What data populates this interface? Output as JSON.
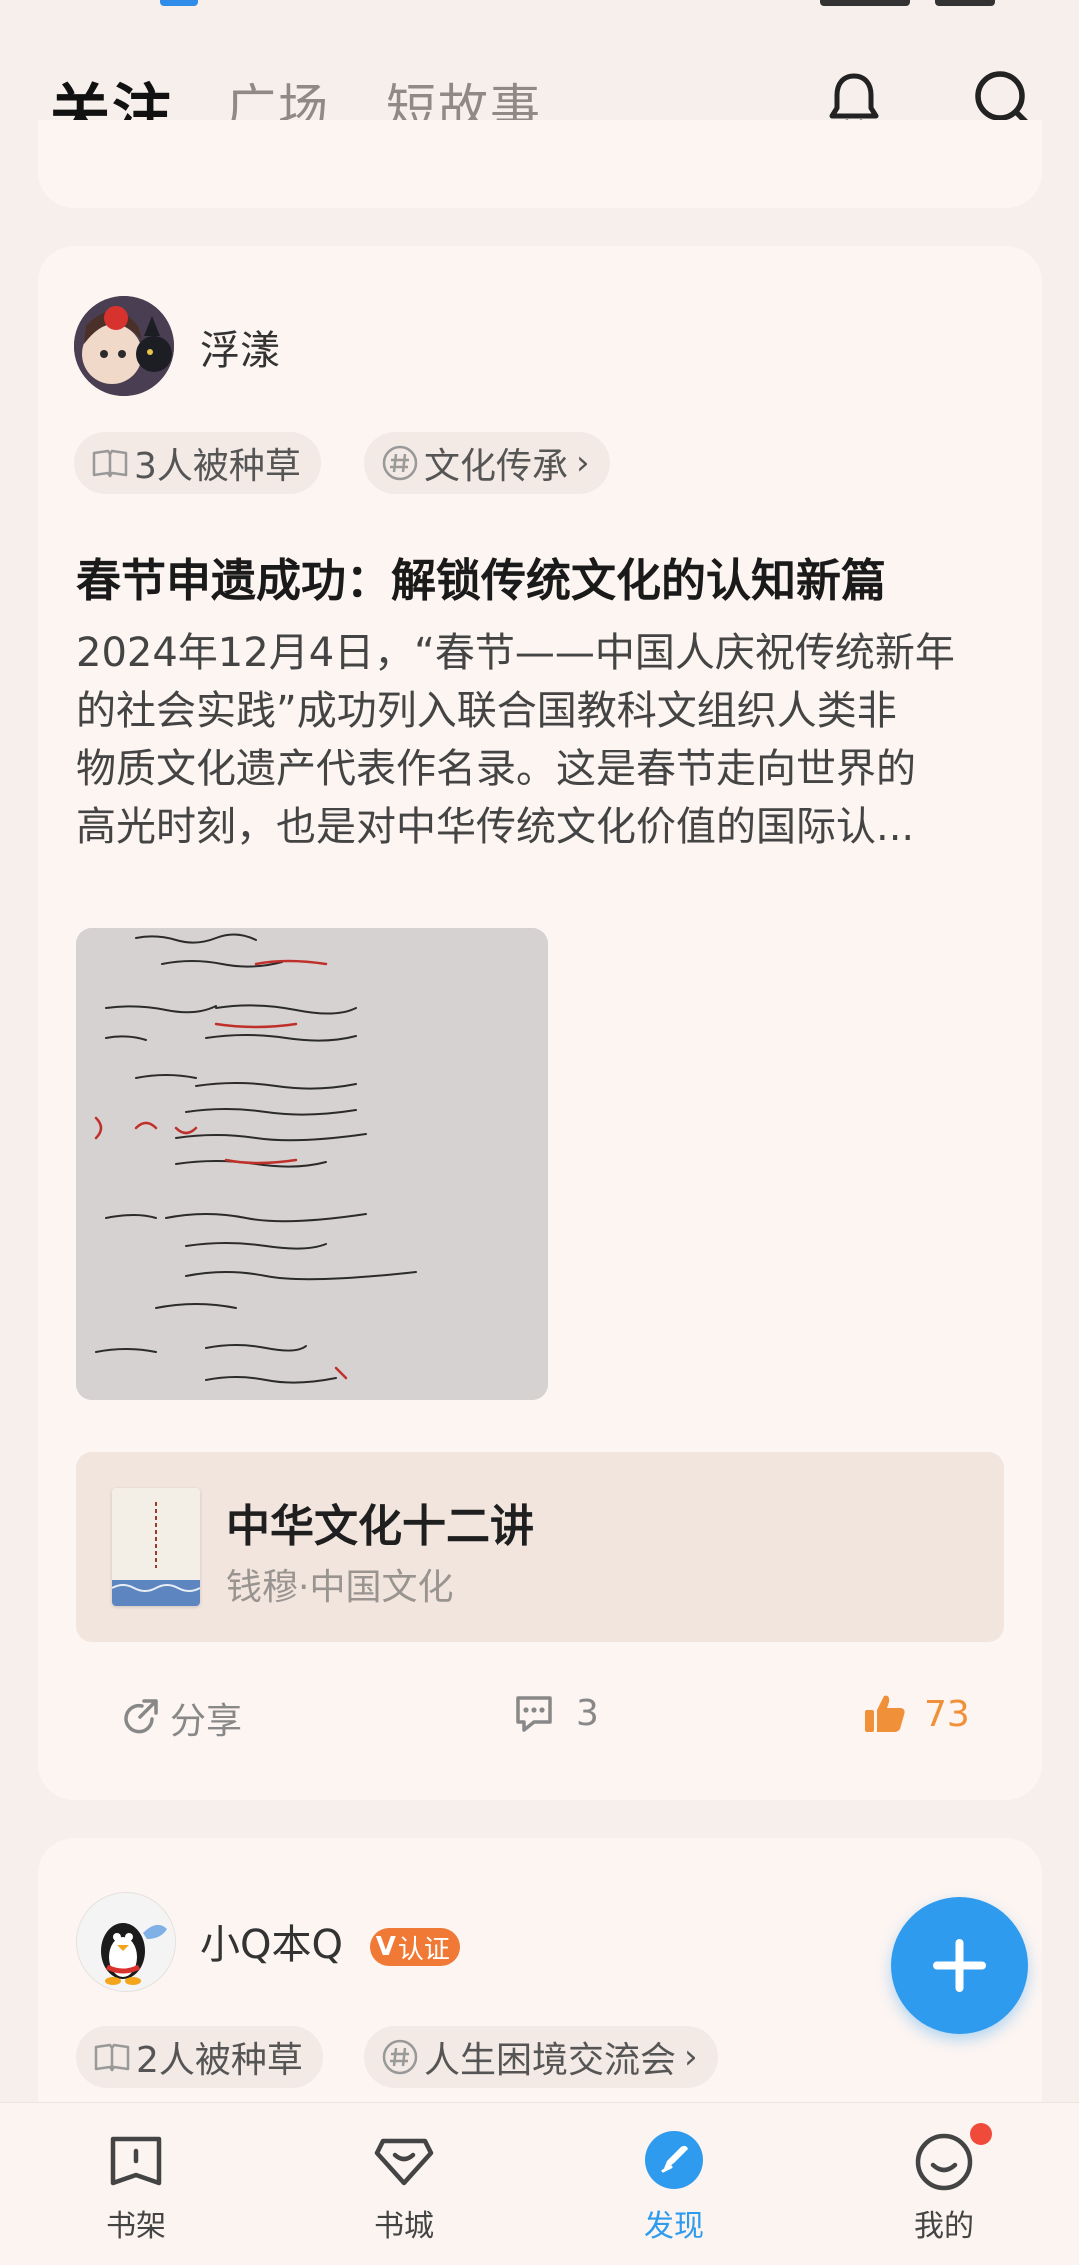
{
  "tabs": [
    {
      "label": "关注",
      "active": true
    },
    {
      "label": "广场",
      "active": false
    },
    {
      "label": "短故事",
      "active": false
    }
  ],
  "post": {
    "username": "浮漾",
    "seeded_count": "3人被种草",
    "topic": "文化传承",
    "title": "春节申遗成功：解锁传统文化的认知新篇",
    "body_lines": [
      "2024年12月4日，“春节——中国人庆祝传统新年",
      "的社会实践”成功列入联合国教科文组织人类非",
      "物质文化遗产代表作名录。这是春节走向世界的",
      "高光时刻，也是对中华传统文化价值的国际认..."
    ],
    "book": {
      "title": "中华文化十二讲",
      "meta": "钱穆·中国文化"
    },
    "actions": {
      "share_label": "分享",
      "comment_count": "3",
      "like_count": "73"
    }
  },
  "next_post": {
    "username": "小Q本Q",
    "verified_label": "认证",
    "seeded_count": "2人被种草",
    "topic": "人生困境交流会"
  },
  "bottom_nav": [
    {
      "label": "书架",
      "icon": "bookshelf-icon",
      "active": false
    },
    {
      "label": "书城",
      "icon": "bookstore-icon",
      "active": false
    },
    {
      "label": "发现",
      "icon": "discover-icon",
      "active": true
    },
    {
      "label": "我的",
      "icon": "profile-icon",
      "active": false,
      "badge": true
    }
  ],
  "colors": {
    "accent": "#2f9bee",
    "like": "#f0913a",
    "verified": "#f07a35",
    "badge": "#f04b3a"
  }
}
